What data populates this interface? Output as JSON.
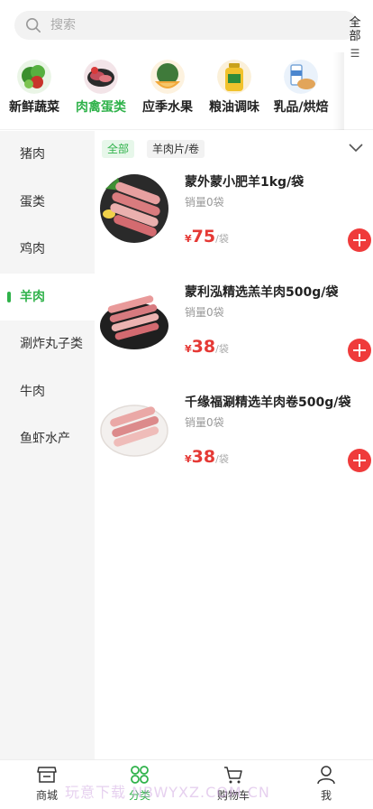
{
  "search": {
    "placeholder": "搜索"
  },
  "categories": {
    "items": [
      {
        "label": "新鲜蔬菜",
        "icon": "vegetable-icon"
      },
      {
        "label": "肉禽蛋类",
        "icon": "meat-icon",
        "active": true
      },
      {
        "label": "应季水果",
        "icon": "fruit-icon"
      },
      {
        "label": "粮油调味",
        "icon": "oil-icon"
      },
      {
        "label": "乳品/烘焙",
        "icon": "dairy-icon"
      }
    ],
    "all_label_1": "全",
    "all_label_2": "部"
  },
  "sidebar": {
    "items": [
      {
        "label": "猪肉"
      },
      {
        "label": "蛋类"
      },
      {
        "label": "鸡肉"
      },
      {
        "label": "羊肉",
        "active": true
      },
      {
        "label": "涮炸丸子类"
      },
      {
        "label": "牛肉"
      },
      {
        "label": "鱼虾水产"
      }
    ]
  },
  "filters": {
    "all": "全部",
    "sub": "羊肉片/卷"
  },
  "products": [
    {
      "name": "蒙外蒙小肥羊1kg/袋",
      "sales": "销量0袋",
      "currency": "¥",
      "price": "75",
      "unit": "/袋"
    },
    {
      "name": "蒙利泓精选羔羊肉500g/袋",
      "sales": "销量0袋",
      "currency": "¥",
      "price": "38",
      "unit": "/袋"
    },
    {
      "name": "千缘福涮精选羊肉卷500g/袋",
      "sales": "销量0袋",
      "currency": "¥",
      "price": "38",
      "unit": "/袋"
    }
  ],
  "tabbar": {
    "items": [
      {
        "label": "商城",
        "icon": "store-icon"
      },
      {
        "label": "分类",
        "icon": "category-icon",
        "active": true
      },
      {
        "label": "购物车",
        "icon": "cart-icon"
      },
      {
        "label": "我",
        "icon": "user-icon"
      }
    ]
  },
  "watermark": "玩意下载 NBWYXZ.COM.CN",
  "colors": {
    "accent": "#2fb24a",
    "price": "#e53935",
    "add_button": "#ef3b3b"
  }
}
